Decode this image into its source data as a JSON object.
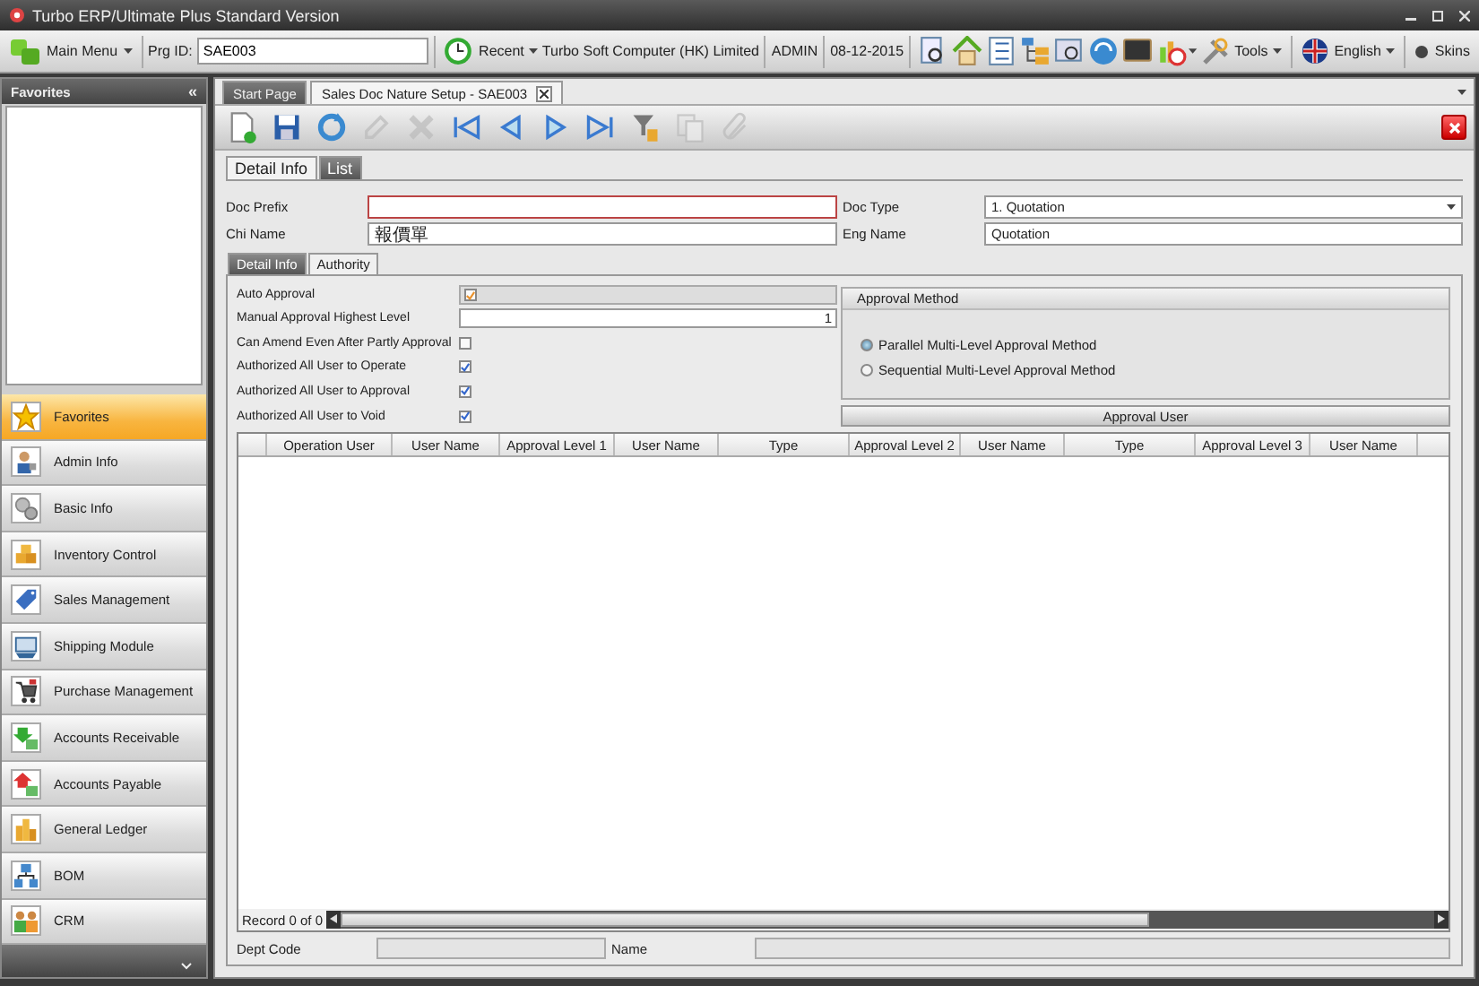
{
  "window": {
    "title": "Turbo ERP/Ultimate Plus Standard Version"
  },
  "toolbar": {
    "main_menu": "Main Menu",
    "prg_id_label": "Prg ID:",
    "prg_id_value": "SAE003",
    "recent": "Recent",
    "company": "Turbo Soft Computer (HK) Limited",
    "user": "ADMIN",
    "date": "08-12-2015",
    "tools": "Tools",
    "language": "English",
    "skins": "Skins"
  },
  "sidebar": {
    "header": "Favorites",
    "collapse": "«",
    "items": [
      {
        "label": "Favorites",
        "kind": "star",
        "selected": true
      },
      {
        "label": "Admin Info",
        "kind": "person",
        "selected": false
      },
      {
        "label": "Basic Info",
        "kind": "gears",
        "selected": false
      },
      {
        "label": "Inventory Control",
        "kind": "boxes",
        "selected": false
      },
      {
        "label": "Sales Management",
        "kind": "tag",
        "selected": false
      },
      {
        "label": "Shipping Module",
        "kind": "ship",
        "selected": false
      },
      {
        "label": "Purchase Management",
        "kind": "cart",
        "selected": false
      },
      {
        "label": "Accounts Receivable",
        "kind": "down",
        "selected": false
      },
      {
        "label": "Accounts Payable",
        "kind": "up",
        "selected": false
      },
      {
        "label": "General Ledger",
        "kind": "coins",
        "selected": false
      },
      {
        "label": "BOM",
        "kind": "tree",
        "selected": false
      },
      {
        "label": "CRM",
        "kind": "people",
        "selected": false
      }
    ]
  },
  "doc_tabs": [
    {
      "label": "Start Page",
      "selected": false,
      "closable": false
    },
    {
      "label": "Sales Doc Nature Setup - SAE003",
      "selected": true,
      "closable": true
    }
  ],
  "doc_toolbar": [
    {
      "kind": "new",
      "disabled": false
    },
    {
      "kind": "save",
      "disabled": false
    },
    {
      "kind": "refresh",
      "disabled": false
    },
    {
      "kind": "edit",
      "disabled": true
    },
    {
      "kind": "delete",
      "disabled": true
    },
    {
      "kind": "first",
      "disabled": false
    },
    {
      "kind": "prev",
      "disabled": false
    },
    {
      "kind": "next",
      "disabled": false
    },
    {
      "kind": "last",
      "disabled": false
    },
    {
      "kind": "filter",
      "disabled": false
    },
    {
      "kind": "copy",
      "disabled": true
    },
    {
      "kind": "attach",
      "disabled": true
    }
  ],
  "form_tabs": [
    {
      "label": "Detail Info",
      "selected": true
    },
    {
      "label": "List",
      "selected": false
    }
  ],
  "header_fields": [
    {
      "label": "Doc Prefix",
      "required": true
    },
    {
      "label": "Doc Type",
      "value": "1. Quotation",
      "kind": "select",
      "required": false
    },
    {
      "label": "Chi Name",
      "value": "報價單",
      "required": false
    },
    {
      "label": "Eng Name",
      "value": "Quotation",
      "required": false
    }
  ],
  "sub_tabs": [
    {
      "label": "Detail Info",
      "selected": false
    },
    {
      "label": "Authority",
      "selected": true
    }
  ],
  "authority": {
    "auto_approval": {
      "label": "Auto Approval",
      "checked": true
    },
    "highest_level": {
      "label": "Manual Approval Highest Level",
      "value": "1"
    },
    "options": [
      {
        "label": "Can Amend Even After Partly Approval",
        "checked": false
      },
      {
        "label": "Authorized All User to Operate",
        "checked": true
      },
      {
        "label": "Authorized All User to Approval",
        "checked": true
      },
      {
        "label": "Authorized All User to Void",
        "checked": true
      }
    ]
  },
  "approval_method": {
    "title": "Approval Method",
    "options": [
      {
        "label": "Parallel Multi-Level Approval Method",
        "selected": true
      },
      {
        "label": "Sequential Multi-Level Approval Method",
        "selected": false
      }
    ]
  },
  "approval_user_button": "Approval User",
  "grid": {
    "columns": [
      "Operation User",
      "User Name",
      "Approval Level 1",
      "User Name",
      "Type",
      "Approval Level 2",
      "User Name",
      "Type",
      "Approval Level 3",
      "User Name"
    ],
    "record": "Record 0 of 0"
  },
  "footer_fields": [
    {
      "label": "Dept Code"
    },
    {
      "label": "Name"
    }
  ]
}
